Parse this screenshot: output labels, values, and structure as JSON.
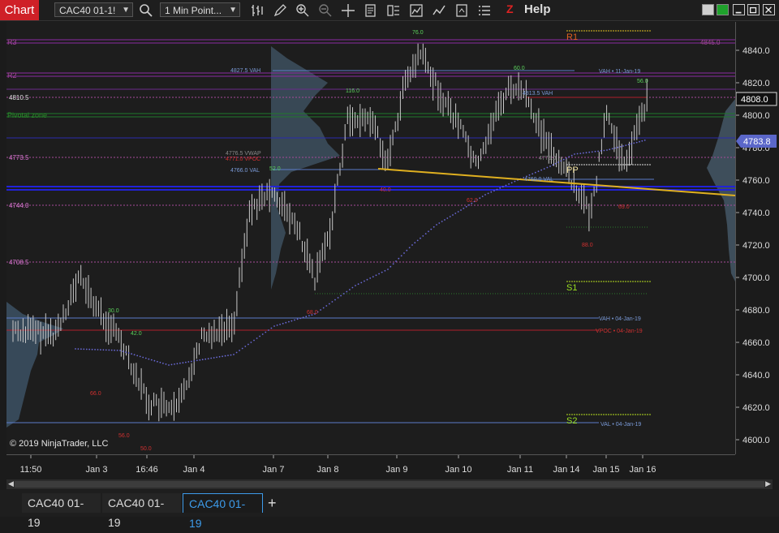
{
  "toolbar": {
    "chart_label": "Chart",
    "instrument": "CAC40 01-1!",
    "interval": "1 Min Point...",
    "help_label": "Help"
  },
  "price_axis": {
    "ticks": [
      "4840.0",
      "4820.0",
      "4800.0",
      "4780.0",
      "4760.0",
      "4740.0",
      "4720.0",
      "4700.0",
      "4680.0",
      "4660.0",
      "4640.0",
      "4620.0",
      "4600.0"
    ],
    "last_price": "4808.0",
    "current_price": "4783.8",
    "current_price_color": "#5b67c9"
  },
  "time_axis": {
    "labels": [
      "11:50",
      "Jan 3",
      "16:46",
      "Jan 4",
      "Jan 7",
      "Jan 8",
      "Jan 9",
      "Jan 10",
      "Jan 11",
      "Jan 14",
      "Jan 15",
      "Jan 16"
    ]
  },
  "levels": {
    "r3": "R3",
    "r2": "R2",
    "pivotal_zone": "Pivotal zone",
    "l1": "4810.5",
    "l2": "4773.5",
    "l3": "4744.0",
    "l4": "4708.5",
    "r1": "R1",
    "pp": "PP",
    "s1": "S1",
    "s2": "S2",
    "r3_right": "4845.0",
    "vah_label": "4827.5 VAH",
    "vah_11": "VAH • 11-Jan-19",
    "vah_04": "VAH • 04-Jan-19",
    "vpoc_04": "VPOC • 04-Jan-19",
    "val_04": "VAL • 04-Jan-19",
    "vwap": "4776.5 VWAP",
    "vpoc": "4771.0 VPOC",
    "val": "4766.0 VAL",
    "vah_8": "4813.5 VAH",
    "val_8": "4760.0 VAL",
    "mid_label": "4775.0"
  },
  "swing_labels": {
    "s76": "76.0",
    "s116": "116.0",
    "s60": "60.0",
    "s56": "56.0",
    "s30": "30.0",
    "s42": "42.0",
    "s52": "52.0",
    "s40": "40.0",
    "s62": "62.0",
    "s68": "68.0",
    "s66": "66.0",
    "s56b": "56.0",
    "s50": "50.0",
    "s88": "88.0",
    "s69": "69.0"
  },
  "copyright": "© 2019 NinjaTrader, LLC",
  "tabs": [
    "CAC40 01-19",
    "CAC40 01-19",
    "CAC40 01-19"
  ],
  "colors": {
    "accent": "#3d9bea",
    "chart_red": "#cf2027",
    "bars": "#c8c8c8",
    "vwap_dots": "#6a6ad8",
    "trendline": "#e0b020"
  }
}
